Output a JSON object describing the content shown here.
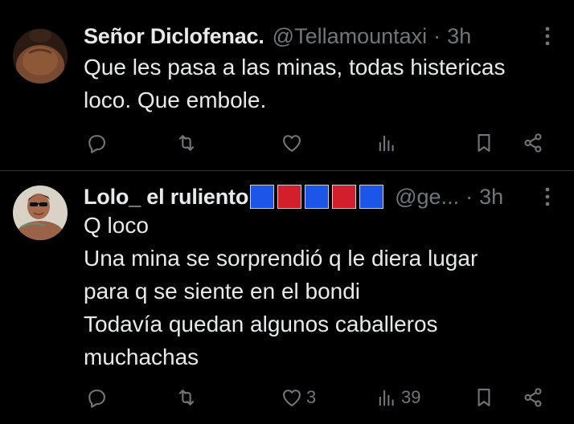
{
  "posts": [
    {
      "author": {
        "display_name": "Señor Diclofenac.",
        "handle": "@Tellamountaxi",
        "separator": "·",
        "time": "3h",
        "avatar_icon": "shirtless-back-photo-avatar",
        "badge_colors": []
      },
      "text_lines": [
        "Que les pasa a las minas, todas histericas",
        "loco. Que embole."
      ],
      "actions": {
        "reply_count": "",
        "repost_count": "",
        "like_count": "",
        "view_count": ""
      }
    },
    {
      "author": {
        "display_name": "Lolo_ el ruliento",
        "handle": "@ge...",
        "separator": "·",
        "time": "3h",
        "avatar_icon": "man-with-sunglasses-photo-avatar",
        "badge_colors": [
          "#1c56e8",
          "#d31f2c",
          "#1c56e8",
          "#d31f2c",
          "#1c56e8"
        ]
      },
      "text_lines": [
        "Q loco",
        "Una mina se sorprendió q le diera lugar",
        "para q se siente en el bondi",
        "Todavía quedan algunos caballeros",
        "muchachas"
      ],
      "actions": {
        "reply_count": "",
        "repost_count": "",
        "like_count": "3",
        "view_count": "39"
      }
    }
  ],
  "theme": {
    "background": "#000000",
    "text_primary": "#e7e9ea",
    "text_secondary": "#71767b",
    "divider": "#2f3336"
  },
  "icons": [
    "reply-icon",
    "repost-icon",
    "like-icon",
    "views-icon",
    "bookmark-icon",
    "share-icon",
    "more-icon"
  ]
}
